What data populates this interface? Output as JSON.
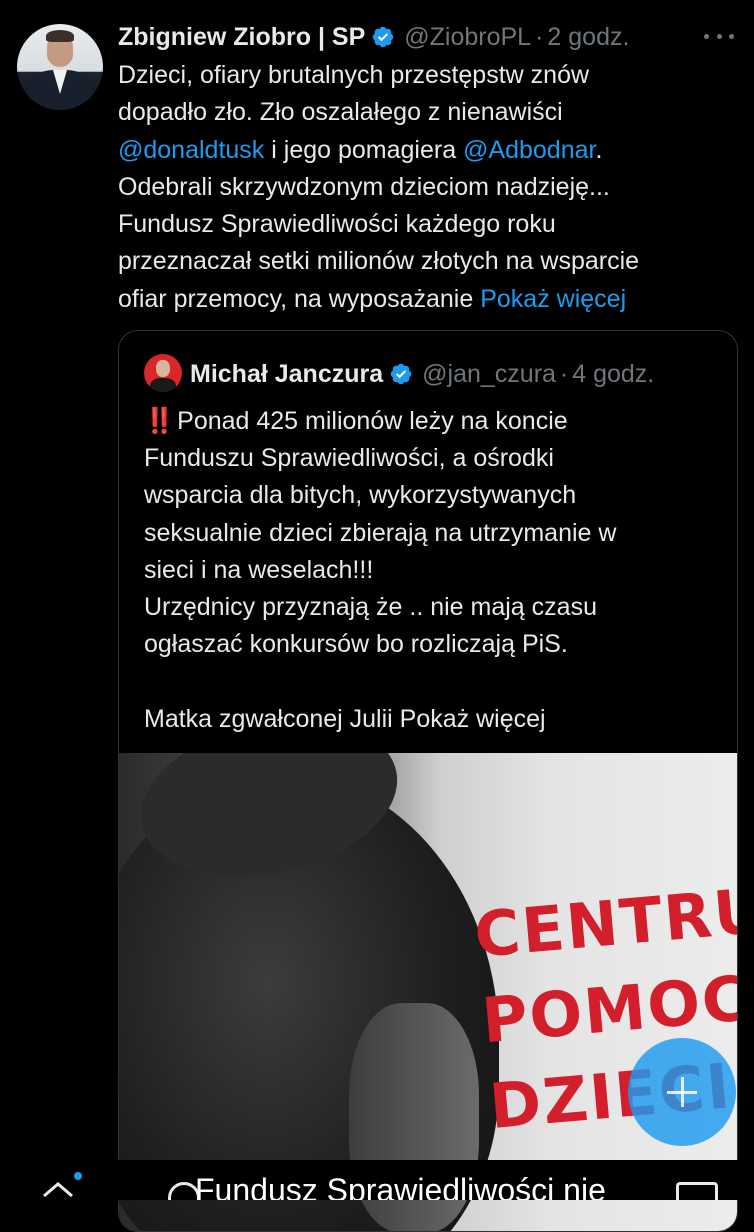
{
  "tweet": {
    "author_name": "Zbigniew Ziobro | SP",
    "handle": "@ZiobroPL",
    "separator": "·",
    "time": "2 godz.",
    "text_lines": [
      [
        "Dzieci, ofiary brutalnych przestępstw znów"
      ],
      [
        "dopadło zło. Zło oszalałego z nienawiści"
      ],
      [
        "@donaldtusk",
        " i jego pomagiera ",
        "@Adbodnar",
        "."
      ],
      [
        "Odebrali skrzywdzonym dzieciom nadzieję..."
      ],
      [
        "Fundusz Sprawiedliwości każdego roku"
      ],
      [
        "przeznaczał setki milionów złotych na wsparcie"
      ],
      [
        "ofiar przemocy, na wyposażanie ",
        "Pokaż więcej"
      ]
    ],
    "mention_1": "@donaldtusk",
    "mention_2": "@Adbodnar",
    "show_more": "Pokaż więcej"
  },
  "quote": {
    "author_name": "Michał Janczura",
    "handle": "@jan_czura",
    "separator": "·",
    "time": "4 godz.",
    "emoji": "‼️",
    "lines": [
      "Ponad 425 milionów leży na koncie",
      "Funduszu Sprawiedliwości, a ośrodki",
      "wsparcia dla bitych, wykorzystywanych",
      "seksualnie dzieci zbierają na utrzymanie w",
      "sieci i na weselach!!!",
      "Urzędnicy przyznają że .. nie mają czasu",
      "ogłaszać konkursów bo rozliczają PiS.",
      "",
      "Matka zgwałconej Julii Pokaż więcej"
    ],
    "media": {
      "sign_line_1": "CENTRU",
      "sign_line_2": "POMOC",
      "sign_line_3": "DZIECI"
    }
  },
  "bottom": {
    "overlay_text": "Fundusz Sprawiedliwości nie"
  },
  "colors": {
    "background": "#000000",
    "text": "#e7e9ea",
    "muted": "#71767b",
    "link": "#1d9bf0",
    "border": "#2f3336",
    "sign_red": "#d21f2b"
  },
  "icons": {
    "verified": "verified-badge-icon",
    "more": "more-icon",
    "compose": "compose-plus-icon"
  }
}
